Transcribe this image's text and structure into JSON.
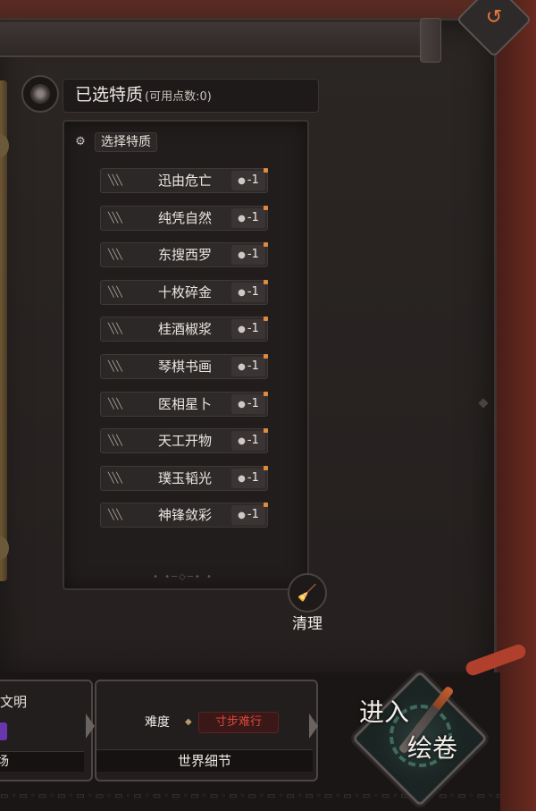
{
  "header": {
    "title": "已选特质",
    "subtitle": "(可用点数:0)",
    "emblem_icon": "sun-emblem-icon"
  },
  "top_controls": {
    "undo_icon": "undo-icon",
    "undo_glyph": "↺"
  },
  "trait_list": {
    "heading": "选择特质",
    "heading_icon": "select-icon",
    "items": [
      {
        "name": "迅由危亡",
        "cost": "-1"
      },
      {
        "name": "纯凭自然",
        "cost": "-1"
      },
      {
        "name": "东搜西罗",
        "cost": "-1"
      },
      {
        "name": "十枚碎金",
        "cost": "-1"
      },
      {
        "name": "桂酒椒浆",
        "cost": "-1"
      },
      {
        "name": "琴棋书画",
        "cost": "-1"
      },
      {
        "name": "医相星卜",
        "cost": "-1"
      },
      {
        "name": "天工开物",
        "cost": "-1"
      },
      {
        "name": "璞玉韬光",
        "cost": "-1"
      },
      {
        "name": "神锋敛彩",
        "cost": "-1"
      }
    ]
  },
  "clear": {
    "label": "清理",
    "icon": "broom-icon"
  },
  "bottom": {
    "left_card": {
      "title": "文明",
      "footer": "场"
    },
    "right_card": {
      "difficulty_label": "难度",
      "difficulty_value": "寸步难行",
      "footer": "世界细节"
    },
    "enter": {
      "line1": "进入",
      "line2": "绘卷",
      "icon": "brush-wheel-icon"
    }
  },
  "colors": {
    "accent": "#e07b3a",
    "difficulty_red": "#d84a3a",
    "text": "#ece7e2"
  }
}
